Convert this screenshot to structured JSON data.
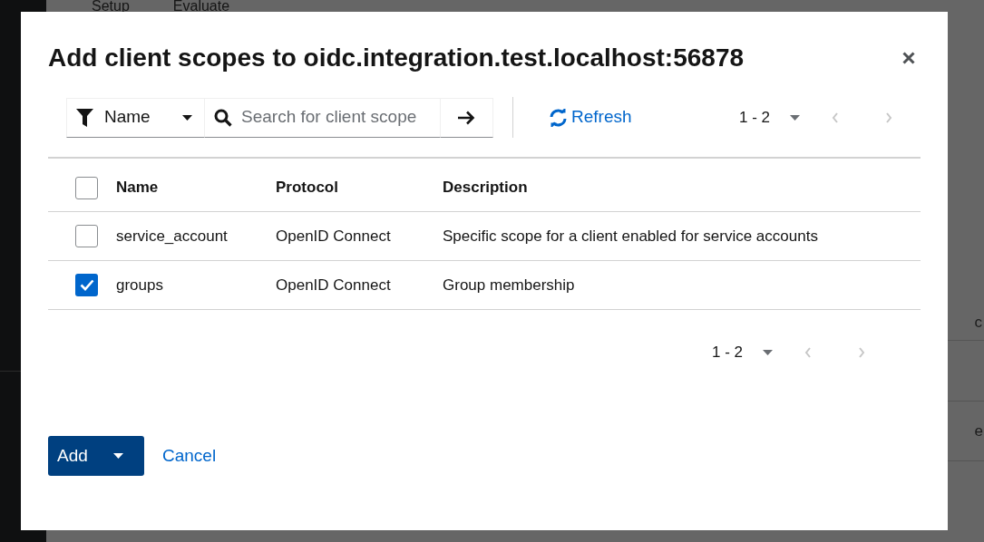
{
  "background": {
    "tabs": [
      {
        "label": "Setup"
      },
      {
        "label": "Evaluate"
      }
    ],
    "fragments": [
      "c",
      "e"
    ]
  },
  "modal": {
    "title": "Add client scopes to oidc.integration.test.localhost:56878",
    "toolbar": {
      "filter": "Name",
      "search": {
        "placeholder": "Search for client scope"
      },
      "refresh": "Refresh",
      "pagination": {
        "range": "1 - 2",
        "prev_disabled": true,
        "next_disabled": true
      }
    },
    "table": {
      "select_all": {
        "checked": false
      },
      "columns": [
        "Name",
        "Protocol",
        "Description"
      ],
      "rows": [
        {
          "name": "service_account",
          "protocol": "OpenID Connect",
          "description": "Specific scope for a client enabled for service accounts",
          "checked": false
        },
        {
          "name": "groups",
          "protocol": "OpenID Connect",
          "description": "Group membership",
          "checked": true
        }
      ]
    },
    "bottom_pagination": {
      "range": "1 - 2",
      "prev_disabled": true,
      "next_disabled": true
    },
    "buttons": {
      "add": "Add",
      "cancel": "Cancel"
    }
  }
}
